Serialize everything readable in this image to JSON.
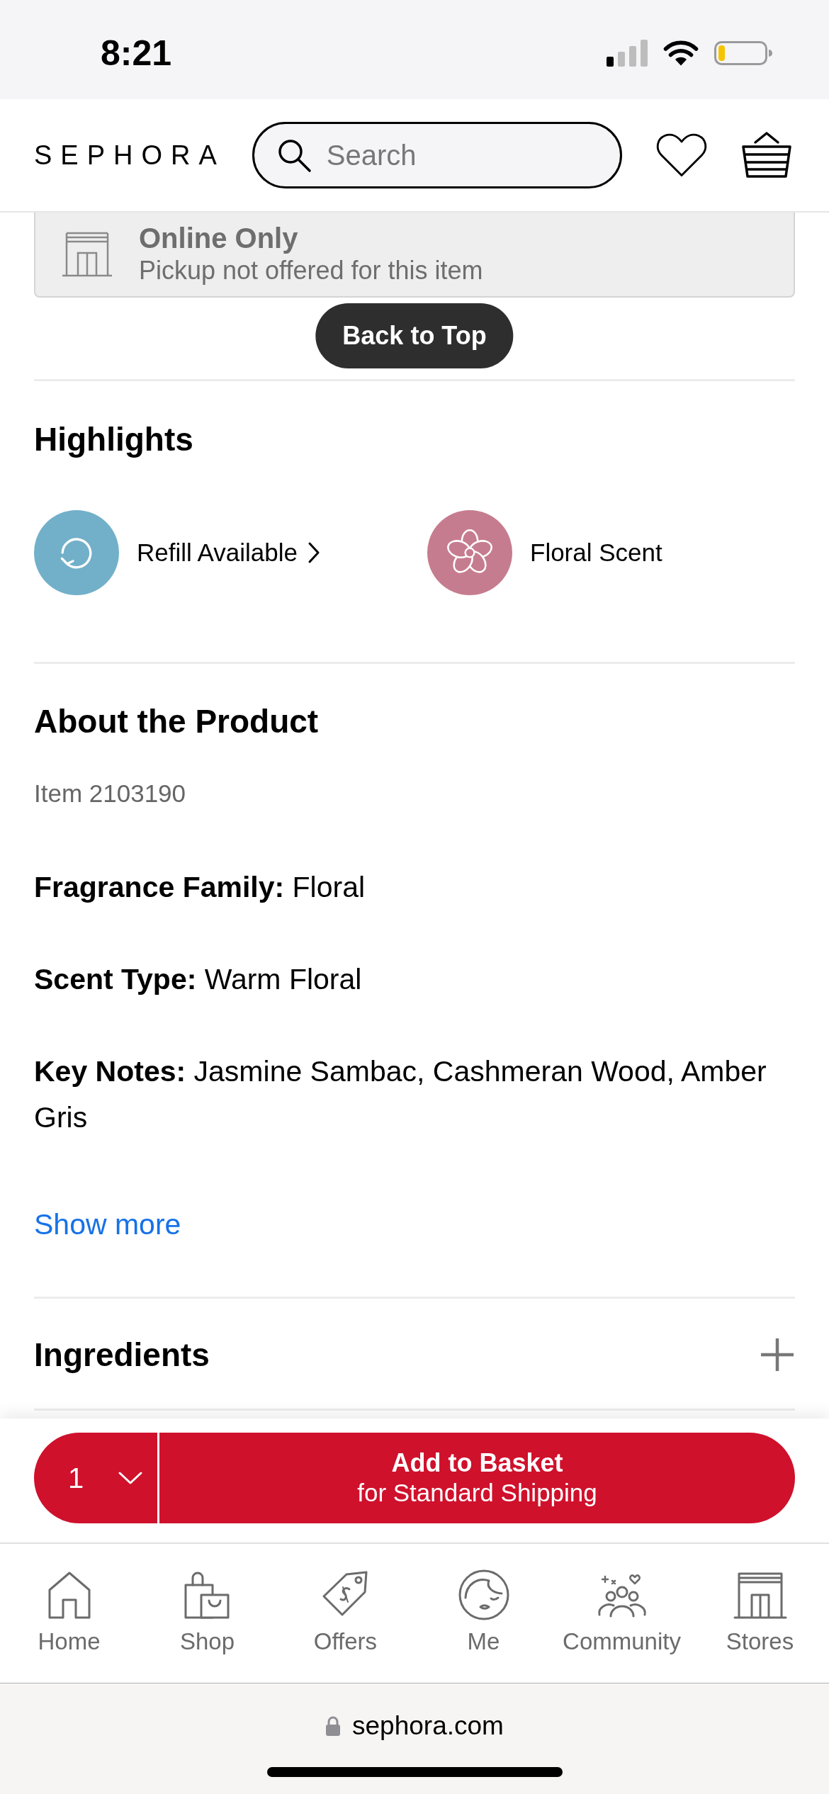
{
  "status_bar": {
    "time": "8:21"
  },
  "header": {
    "logo": "SEPHORA",
    "search": {
      "placeholder": "Search"
    }
  },
  "pickup_notice": {
    "title": "Online Only",
    "text": "Pickup not offered for this item"
  },
  "back_to_top": "Back to Top",
  "highlights": {
    "title": "Highlights",
    "items": [
      {
        "kind": "refill",
        "label": "Refill Available",
        "link": true,
        "color": "#72b0c9"
      },
      {
        "kind": "floral",
        "label": "Floral Scent",
        "link": false,
        "color": "#c67c8f"
      }
    ]
  },
  "about": {
    "title": "About the Product",
    "item_number": "Item 2103190",
    "details": [
      "**Fragrance Family:** Floral",
      "**Scent Type:** Warm Floral",
      "**Key Notes:** Jasmine Sambac, Cashmeran Wood, Amber Gris"
    ],
    "show_more": "Show more"
  },
  "ingredients": {
    "title": "Ingredients",
    "expanded": false
  },
  "purchase": {
    "quantity": "1",
    "button_title": "Add to Basket",
    "button_subtitle": "for Standard Shipping"
  },
  "bottom_nav": [
    {
      "kind": "home",
      "label": "Home",
      "selected": false
    },
    {
      "kind": "shop",
      "label": "Shop",
      "selected": false
    },
    {
      "kind": "offers",
      "label": "Offers",
      "selected": false
    },
    {
      "kind": "me",
      "label": "Me",
      "selected": false
    },
    {
      "kind": "community",
      "label": "Community",
      "selected": false
    },
    {
      "kind": "stores",
      "label": "Stores",
      "selected": false
    }
  ],
  "browser_bar": {
    "url": "sephora.com"
  }
}
